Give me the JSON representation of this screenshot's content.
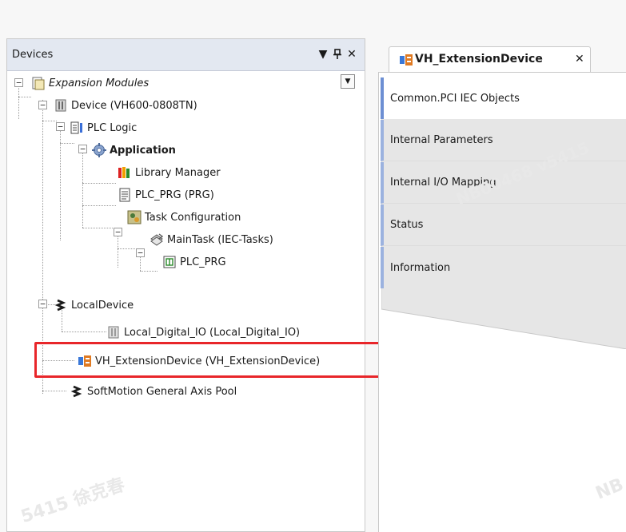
{
  "devices_panel": {
    "title": "Devices",
    "controls": {
      "dropdown": "▼",
      "pin": "⎀",
      "close": "✕"
    }
  },
  "tree": [
    {
      "label": "Expansion Modules",
      "italic": true
    },
    {
      "label": "Device (VH600-0808TN)"
    },
    {
      "label": "PLC Logic"
    },
    {
      "label": "Application",
      "bold": true
    },
    {
      "label": "Library Manager"
    },
    {
      "label": "PLC_PRG (PRG)"
    },
    {
      "label": "Task Configuration"
    },
    {
      "label": "MainTask (IEC-Tasks)"
    },
    {
      "label": "PLC_PRG"
    },
    {
      "label": "LocalDevice"
    },
    {
      "label": "Local_Digital_IO (Local_Digital_IO)"
    },
    {
      "label": "VH_ExtensionDevice (VH_ExtensionDevice)"
    },
    {
      "label": "SoftMotion General Axis Pool"
    }
  ],
  "editor": {
    "tab_title": "VH_ExtensionDevice",
    "tab_close": "✕",
    "side_tabs": [
      "Common.PCI IEC Objects",
      "Internal Parameters",
      "Internal I/O Mapping",
      "Status",
      "Information"
    ]
  },
  "watermarks": [
    "NB00468 v5415",
    "5415 徐克春",
    "NB"
  ],
  "colors": {
    "highlight": "#e8262a",
    "title_bar": "#e3e8f1",
    "tab_accent": "#6d8fd3"
  }
}
